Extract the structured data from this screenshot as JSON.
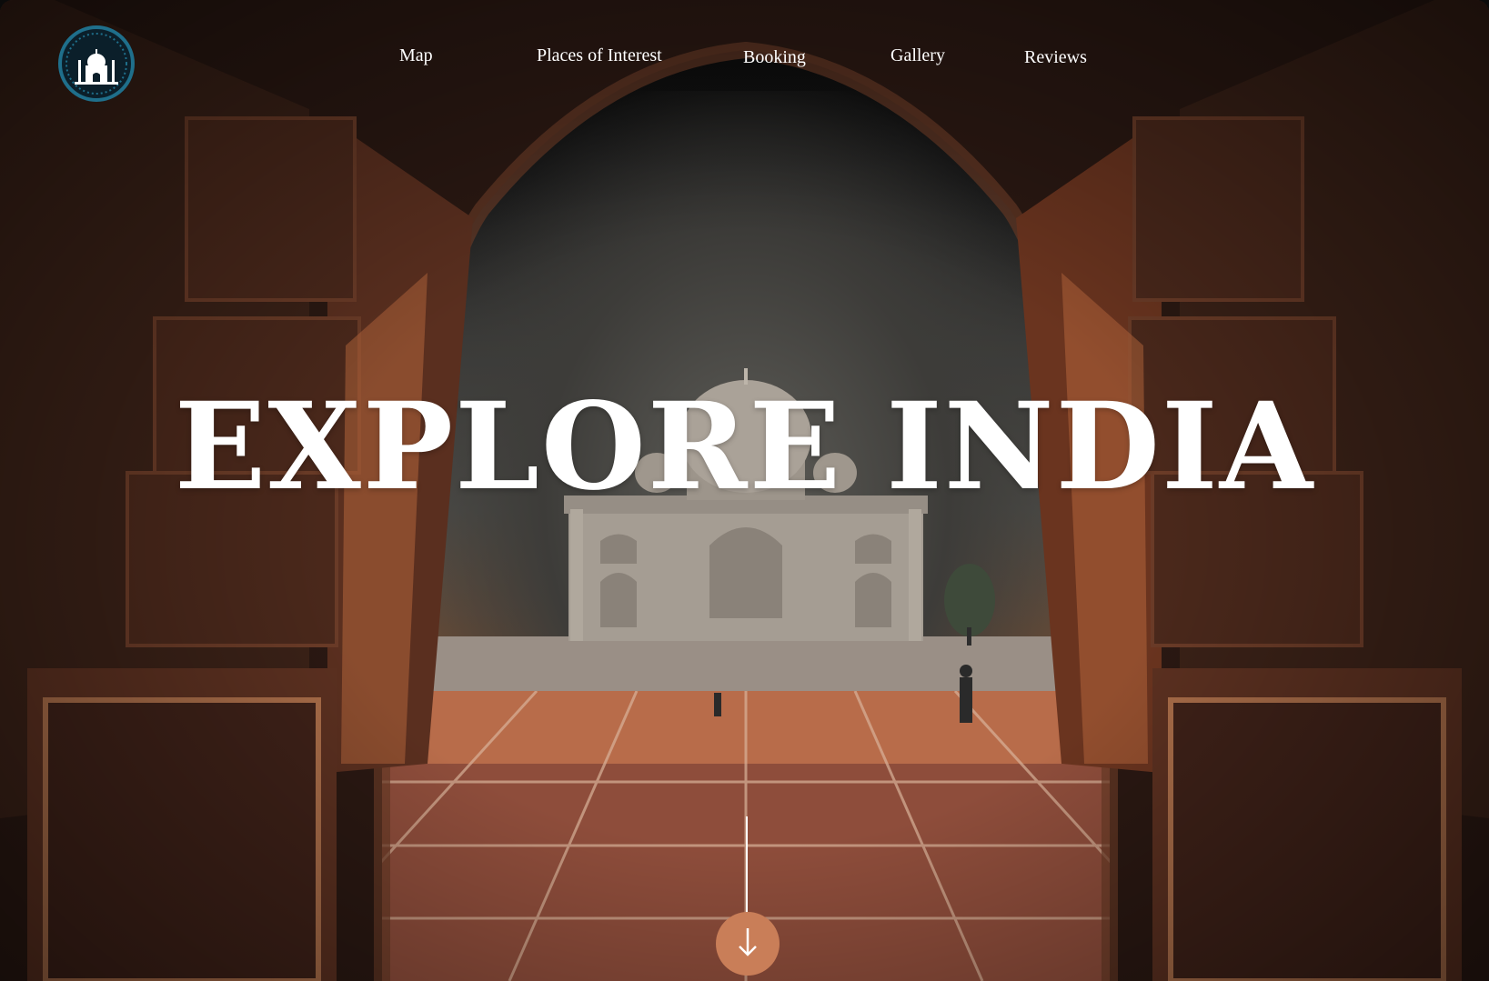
{
  "brand": {
    "logo_icon": "taj-mahal-logo-icon",
    "logo_color": "#1f6f8b"
  },
  "nav": {
    "items": [
      {
        "label": "Map"
      },
      {
        "label": "Places of Interest"
      },
      {
        "label": "Booking"
      },
      {
        "label": "Gallery"
      },
      {
        "label": "Reviews"
      }
    ]
  },
  "hero": {
    "headline": "EXPLORE INDIA",
    "background": "archway-view-of-taj-mahal",
    "accent_color": "#c97e58"
  },
  "scroll": {
    "icon": "arrow-down-icon"
  }
}
